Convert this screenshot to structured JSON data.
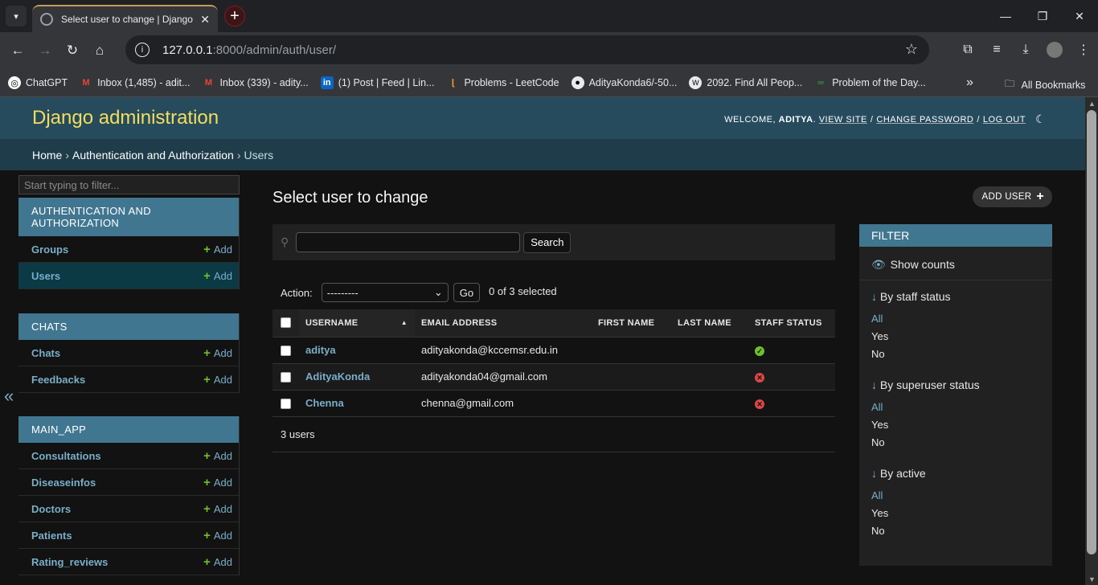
{
  "browser": {
    "tab_title": "Select user to change | Django",
    "url_host": "127.0.0.1",
    "url_rest": ":8000/admin/auth/user/",
    "bookmarks": [
      "ChatGPT",
      "Inbox (1,485) - adit...",
      "Inbox (339) - adity...",
      "(1) Post | Feed | Lin...",
      "Problems - LeetCode",
      "AdityaKonda6/-50...",
      "2092. Find All Peop...",
      "Problem of the Day..."
    ],
    "all_bookmarks": "All Bookmarks"
  },
  "header": {
    "branding": "Django administration",
    "welcome": "WELCOME, ",
    "username": "ADITYA",
    "view_site": "VIEW SITE",
    "change_password": "CHANGE PASSWORD",
    "log_out": "LOG OUT"
  },
  "breadcrumbs": {
    "home": "Home",
    "app": "Authentication and Authorization",
    "current": "Users"
  },
  "sidebar": {
    "filter_placeholder": "Start typing to filter...",
    "add_label": "Add",
    "modules": [
      {
        "caption": "AUTHENTICATION AND AUTHORIZATION",
        "models": [
          "Groups",
          "Users"
        ]
      },
      {
        "caption": "CHATS",
        "models": [
          "Chats",
          "Feedbacks"
        ]
      },
      {
        "caption": "MAIN_APP",
        "models": [
          "Consultations",
          "Diseaseinfos",
          "Doctors",
          "Patients",
          "Rating_reviews"
        ]
      }
    ]
  },
  "content": {
    "title": "Select user to change",
    "add_user": "ADD USER",
    "search_button": "Search",
    "action_label": "Action:",
    "action_selected": "---------",
    "go_button": "Go",
    "selected_count": "0 of 3 selected",
    "columns": [
      "USERNAME",
      "EMAIL ADDRESS",
      "FIRST NAME",
      "LAST NAME",
      "STAFF STATUS"
    ],
    "rows": [
      {
        "username": "aditya",
        "email": "adityakonda@kccemsr.edu.in",
        "first": "",
        "last": "",
        "staff": true
      },
      {
        "username": "AdityaKonda",
        "email": "adityakonda04@gmail.com",
        "first": "",
        "last": "",
        "staff": false
      },
      {
        "username": "Chenna",
        "email": "chenna@gmail.com",
        "first": "",
        "last": "",
        "staff": false
      }
    ],
    "paginator": "3 users"
  },
  "filter": {
    "title": "FILTER",
    "show_counts": "Show counts",
    "sections": [
      {
        "title": "By staff status",
        "options": [
          "All",
          "Yes",
          "No"
        ]
      },
      {
        "title": "By superuser status",
        "options": [
          "All",
          "Yes",
          "No"
        ]
      },
      {
        "title": "By active",
        "options": [
          "All",
          "Yes",
          "No"
        ]
      }
    ]
  }
}
